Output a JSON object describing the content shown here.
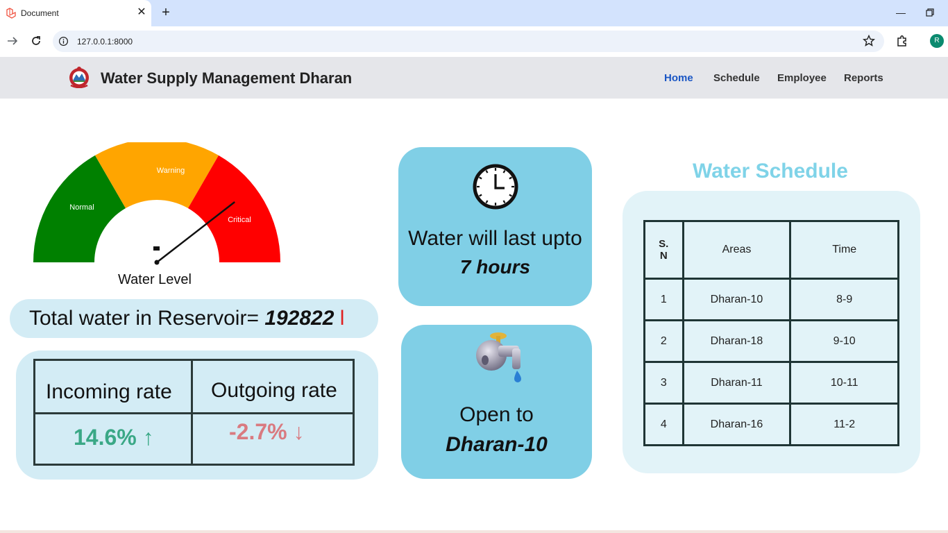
{
  "browser": {
    "tab_title": "Document",
    "url": "127.0.0.1:8000",
    "profile_initial": "R"
  },
  "navbar": {
    "brand": "Water Supply Management Dharan",
    "links": [
      {
        "label": "Home",
        "active": true
      },
      {
        "label": "Schedule",
        "active": false
      },
      {
        "label": "Employee",
        "active": false
      },
      {
        "label": "Reports",
        "active": false
      }
    ]
  },
  "gauge": {
    "zones": [
      "Normal",
      "Warning",
      "Critical"
    ],
    "label": "Water Level",
    "zone_colors": [
      "#008000",
      "#ffa500",
      "#ff0000"
    ],
    "needle_fraction": 0.79
  },
  "reservoir": {
    "label": "Total water in Reservoir=",
    "value": "192822",
    "unit": "l"
  },
  "rates": {
    "incoming_label": "Incoming rate",
    "outgoing_label": "Outgoing rate",
    "incoming_value": "14.6% ↑",
    "outgoing_value": "-2.7% ↓",
    "incoming_color": "#3aa886",
    "outgoing_color": "#d97a80"
  },
  "duration_card": {
    "line1": "Water will last upto",
    "line2": "7 hours"
  },
  "open_card": {
    "line1": "Open to",
    "line2": "Dharan-10"
  },
  "schedule": {
    "title": "Water Schedule",
    "headers": [
      "S.\nN",
      "Areas",
      "Time"
    ],
    "rows": [
      [
        "1",
        "Dharan-10",
        "8-9"
      ],
      [
        "2",
        "Dharan-18",
        "9-10"
      ],
      [
        "3",
        "Dharan-11",
        "10-11"
      ],
      [
        "4",
        "Dharan-16",
        "11-2"
      ]
    ]
  },
  "colors": {
    "navbar_bg": "#e5e6ea",
    "active_link": "#1a56c4",
    "card_bg": "#80cfe6",
    "panel_bg": "#d3ecf5",
    "schedule_title": "#7fd3e8"
  }
}
